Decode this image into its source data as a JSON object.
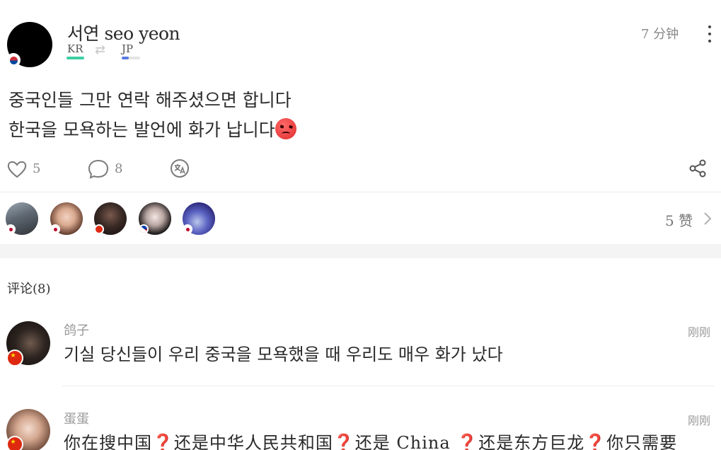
{
  "post": {
    "author": "서연 seo yeon",
    "native_lang": "KR",
    "learning_lang": "JP",
    "time": "7 分钟",
    "author_flag": "kr",
    "lines": [
      "중국인들 그만 연락 해주셨으면 합니다",
      "한국을 모욕하는 발언에 화가 납니다"
    ],
    "emoji": "angry-face",
    "likes": "5",
    "comments_count": "8",
    "likers_count": "5 赞",
    "colors": {
      "native_bar": "#3ccfa3",
      "learning_bar": "#5a7be0"
    }
  },
  "comments_section": {
    "header": "评论(8)",
    "items": [
      {
        "name": "鸽子",
        "time": "刚刚",
        "text": "기실 당신들이 우리 중국을 모욕했을 때 우리도 매우 화가 났다",
        "flag": "cn"
      },
      {
        "name": "蛋蛋",
        "time": "刚刚",
        "text_parts": [
          "你在搜中国",
          "还是中华人民共和国",
          "还是 China ",
          "还是东方巨龙",
          "你只需要"
        ],
        "flag": "cn"
      }
    ]
  }
}
